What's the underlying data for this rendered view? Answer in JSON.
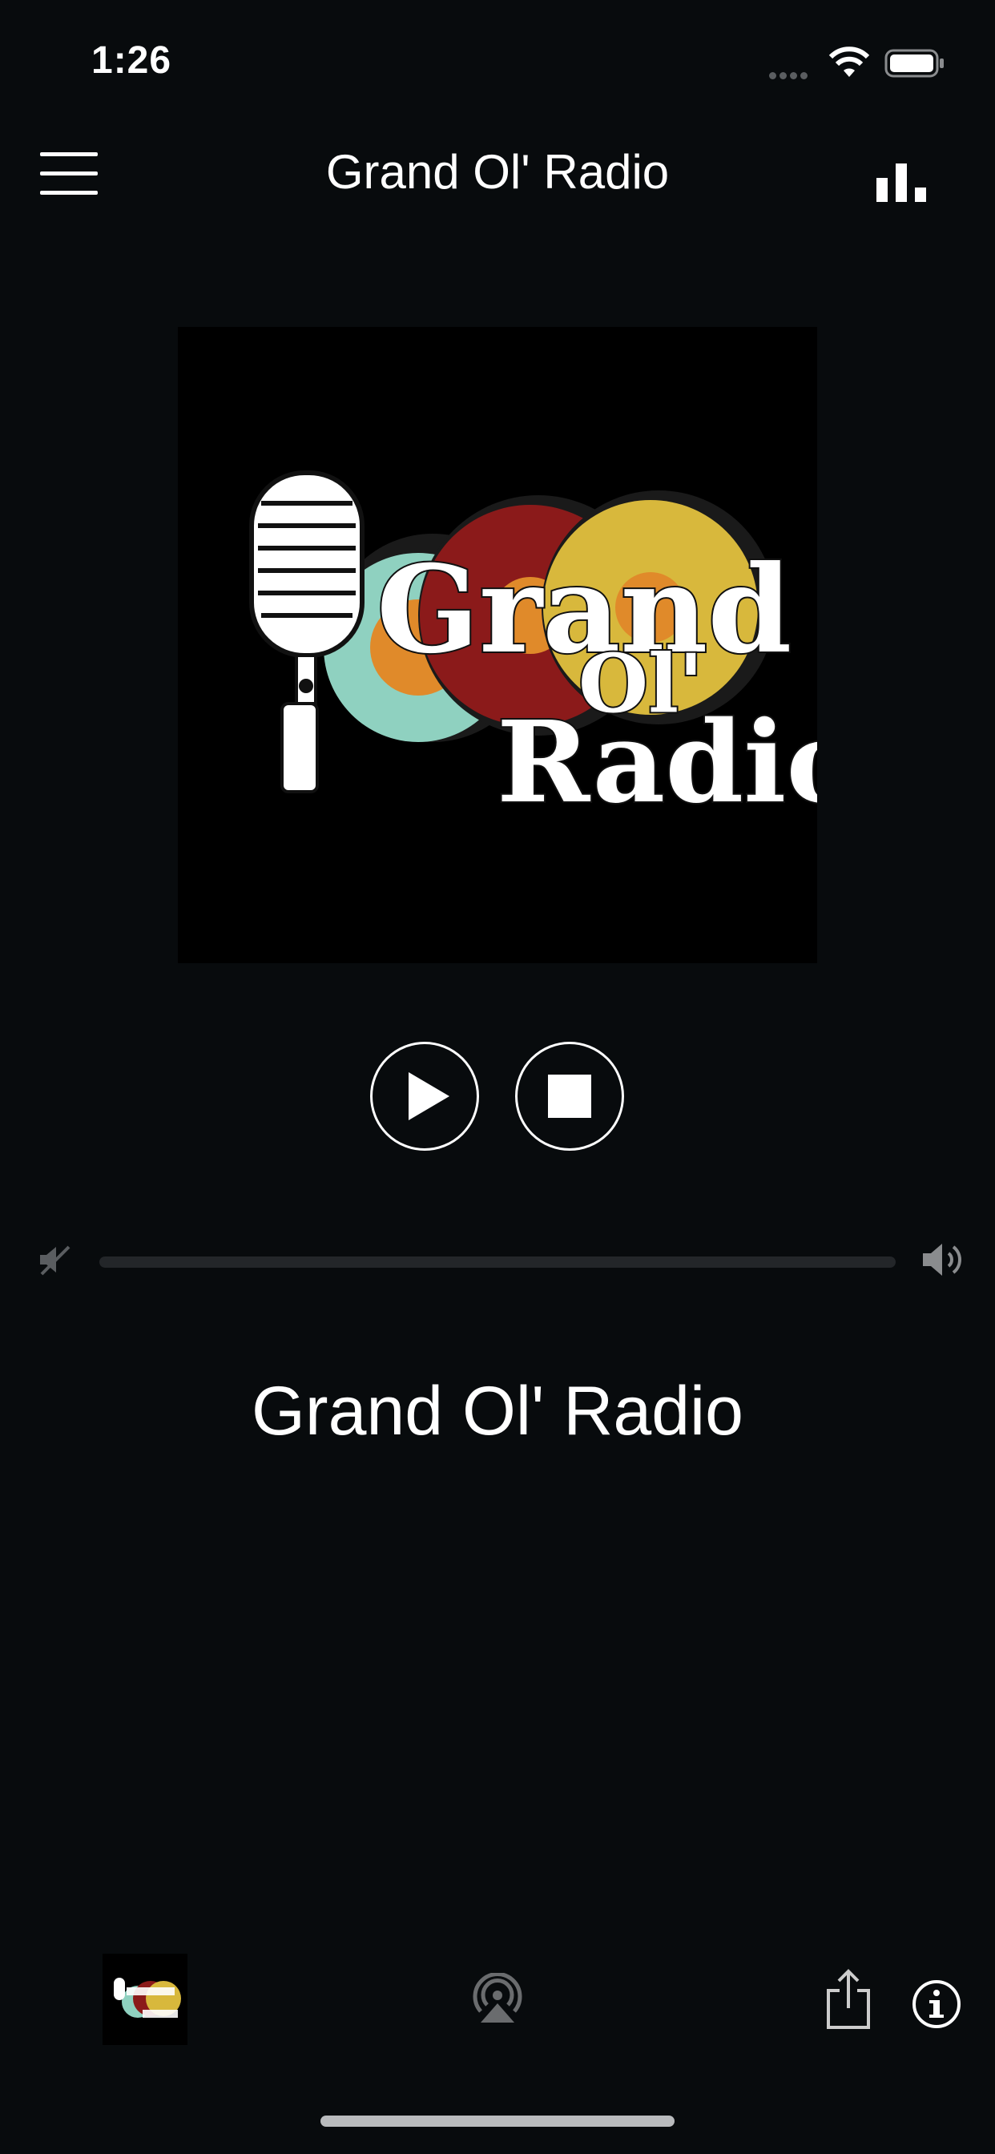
{
  "status_bar": {
    "time": "1:26"
  },
  "nav": {
    "title": "Grand Ol' Radio",
    "menu_icon": "hamburger-menu-icon",
    "stats_icon": "bar-chart-icon"
  },
  "artwork": {
    "logo_text_line1": "Grand",
    "logo_text_line2": "Ol'",
    "logo_text_line3": "Radio",
    "colors": {
      "teal": "#8fd1c0",
      "orange": "#e08a2a",
      "red": "#8b1a1a",
      "yellow": "#d8b83c"
    }
  },
  "controls": {
    "play_icon": "play-icon",
    "stop_icon": "stop-icon"
  },
  "volume": {
    "min_icon": "volume-mute-icon",
    "max_icon": "volume-high-icon",
    "level": 0
  },
  "station": {
    "name": "Grand Ol' Radio"
  },
  "toolbar": {
    "thumbnail_icon": "station-logo-thumbnail",
    "airplay_icon": "airplay-icon",
    "share_icon": "share-icon",
    "info_icon": "info-icon"
  },
  "colors": {
    "background": "#080b0d",
    "foreground": "#ffffff",
    "track": "#232629"
  }
}
